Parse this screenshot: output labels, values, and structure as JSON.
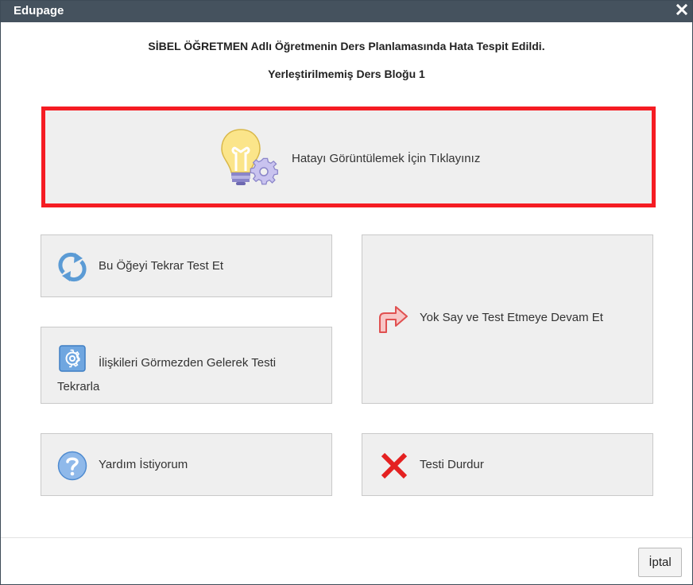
{
  "window": {
    "title": "Edupage",
    "close_icon": "close-icon"
  },
  "message": {
    "line1": "SİBEL ÖĞRETMEN Adlı Öğretmenin Ders Planlamasında Hata Tespit Edildi.",
    "line2": "Yerleştirilmemiş Ders Bloğu 1"
  },
  "actions": {
    "view_error": {
      "label": "Hatayı Görüntülemek İçin Tıklayınız",
      "icon": "lightbulb-gear-icon",
      "highlight_color": "#f51c23"
    },
    "retest_item": {
      "label": "Bu Öğeyi Tekrar Test Et",
      "icon": "refresh-icon"
    },
    "retest_ignore_relations": {
      "label": "İlişkileri Görmezden Gelerek Testi Tekrarla",
      "icon": "settings-gear-icon"
    },
    "ignore_continue": {
      "label": "Yok Say ve Test Etmeye Devam Et",
      "icon": "turn-right-arrow-icon"
    },
    "help": {
      "label": "Yardım İstiyorum",
      "icon": "help-icon"
    },
    "stop_test": {
      "label": "Testi Durdur",
      "icon": "red-x-icon"
    }
  },
  "footer": {
    "cancel_label": "İptal"
  }
}
